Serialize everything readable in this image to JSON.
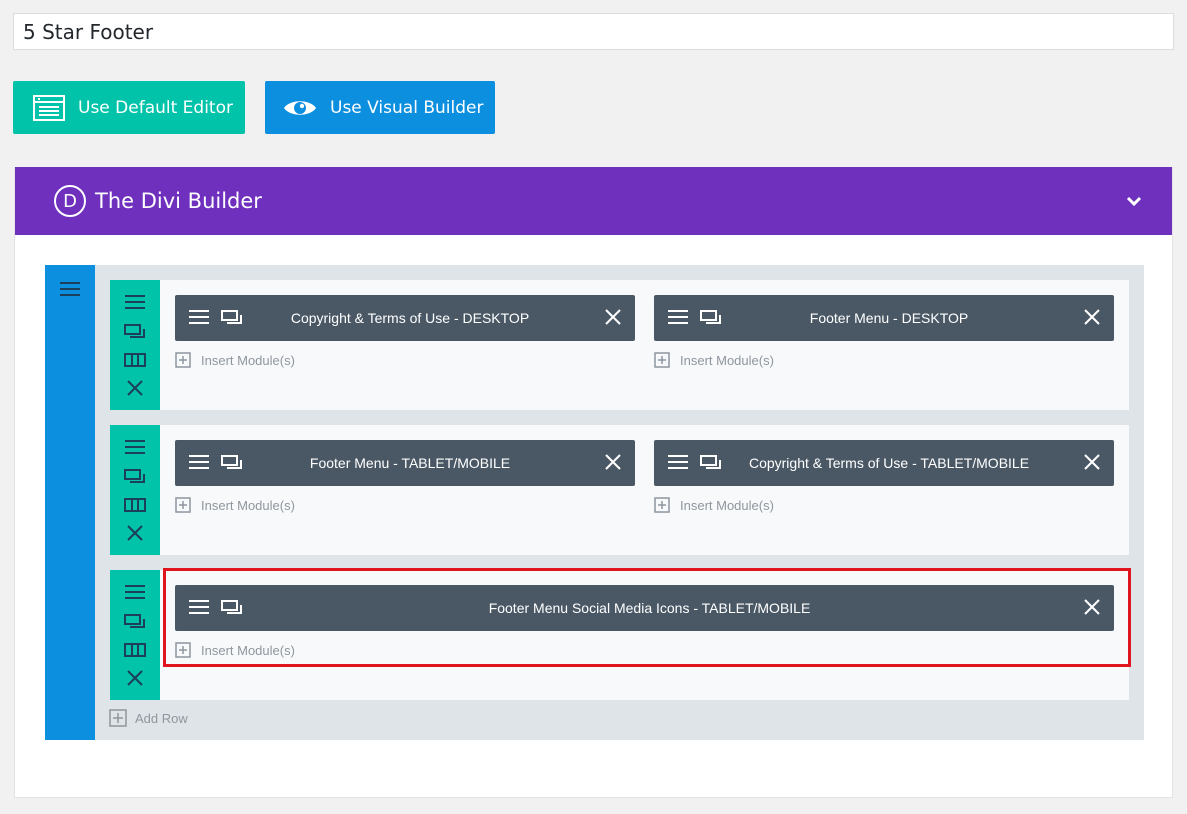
{
  "post": {
    "title_value": "5 Star Footer"
  },
  "editor_buttons": {
    "default_label": "Use Default Editor",
    "visual_label": "Use Visual Builder"
  },
  "builder": {
    "logo_letter": "D",
    "title": "The Divi Builder"
  },
  "rows": [
    {
      "columns": [
        {
          "module": "Copyright & Terms of Use - DESKTOP",
          "insert": "Insert Module(s)"
        },
        {
          "module": "Footer Menu - DESKTOP",
          "insert": "Insert Module(s)"
        }
      ]
    },
    {
      "columns": [
        {
          "module": "Footer Menu - TABLET/MOBILE",
          "insert": "Insert Module(s)"
        },
        {
          "module": "Copyright & Terms of Use - TABLET/MOBILE",
          "insert": "Insert Module(s)"
        }
      ]
    },
    {
      "columns": [
        {
          "module": "Footer Menu Social Media Icons - TABLET/MOBILE",
          "insert": "Insert Module(s)"
        }
      ]
    }
  ],
  "add_row_label": "Add Row",
  "icons": {
    "default_editor": "editor-window-icon",
    "visual_builder": "eye-icon",
    "collapse": "chevron-down-icon",
    "drag": "hamburger-icon",
    "clone": "duplicate-icon",
    "columns": "columns-icon",
    "delete": "close-icon",
    "add": "plus-square-icon"
  },
  "colors": {
    "teal": "#00c3aa",
    "blue": "#0c8fdf",
    "purple": "#6e30bd",
    "module": "#4a5866",
    "highlight": "#e0141e"
  }
}
